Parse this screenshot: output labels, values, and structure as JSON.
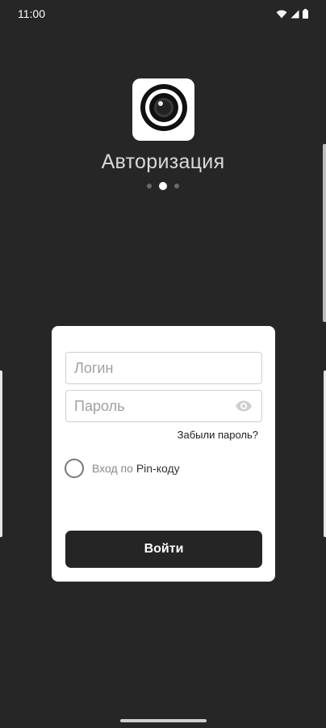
{
  "status_bar": {
    "time": "11:00",
    "icons": [
      "wifi-icon",
      "signal-icon",
      "battery-icon"
    ]
  },
  "header": {
    "logo_icon": "camera-lens-icon",
    "title": "Авторизация",
    "pager": {
      "total": 3,
      "active_index": 1
    }
  },
  "form": {
    "login_placeholder": "Логин",
    "login_value": "",
    "password_placeholder": "Пароль",
    "password_value": "",
    "password_toggle_icon": "eye-icon",
    "forgot_password": "Забыли пароль?",
    "pin_login_prefix": "Вход по",
    "pin_login_suffix": "Pin-коду",
    "pin_checked": false,
    "submit_label": "Войти"
  },
  "colors": {
    "background": "#262626",
    "card": "#ffffff",
    "button": "#252525",
    "title": "#d9d9d9"
  }
}
